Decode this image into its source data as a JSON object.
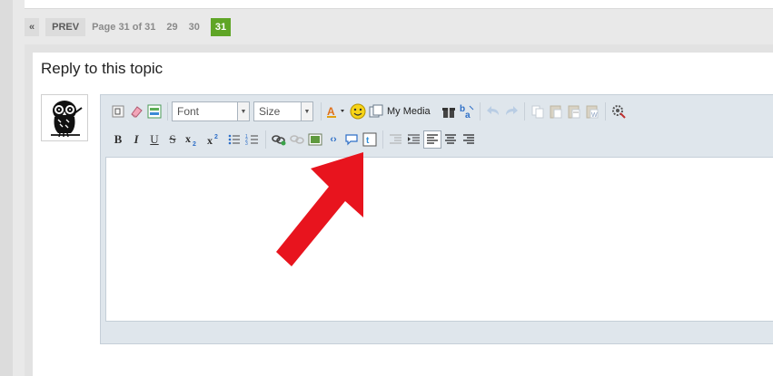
{
  "pagination": {
    "first_label": "«",
    "prev_label": "PREV",
    "page_info": "Page 31 of 31",
    "pages": [
      "29",
      "30"
    ],
    "current_page": "31"
  },
  "reply": {
    "title": "Reply to this topic"
  },
  "editor": {
    "font_select": "Font",
    "size_select": "Size",
    "my_media_label": "My Media",
    "row1_icons": [
      "source-icon",
      "eraser-icon",
      "template-icon",
      "font-select",
      "size-select",
      "text-color-icon",
      "emoticon-icon",
      "my-media-icon",
      "gift-icon",
      "spellcheck-icon",
      "undo-icon",
      "redo-icon",
      "copy-icon",
      "paste-icon",
      "paste-text-icon",
      "paste-word-icon",
      "settings-icon"
    ],
    "row2_icons": [
      "bold",
      "italic",
      "underline",
      "strikethrough",
      "subscript",
      "superscript",
      "bullet-list",
      "numbered-list",
      "link",
      "unlink",
      "image",
      "code",
      "quote",
      "twitter",
      "outdent",
      "indent",
      "align-left",
      "align-center",
      "align-right"
    ]
  },
  "colors": {
    "accent_green": "#5fa526",
    "arrow_red": "#e8141e"
  }
}
